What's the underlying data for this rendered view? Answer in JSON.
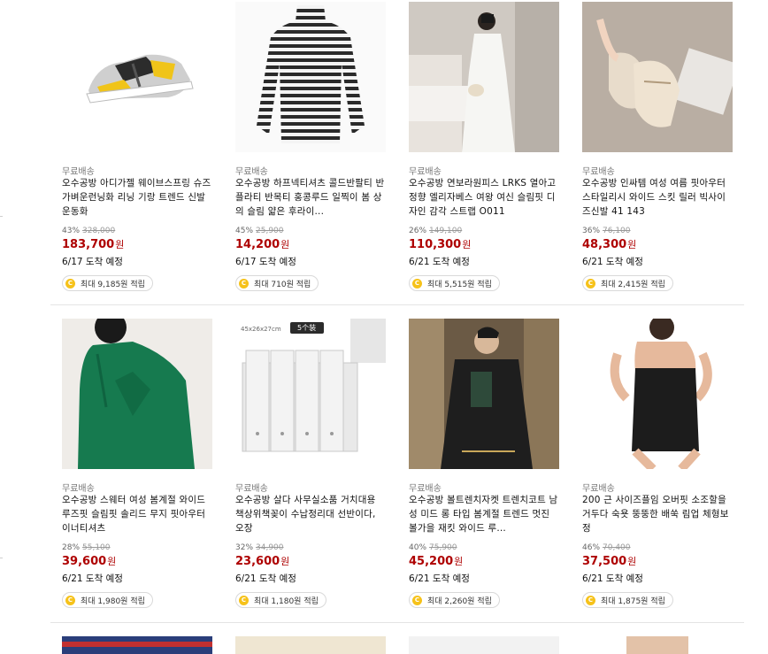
{
  "products": [
    {
      "shipping": "무료배송",
      "title": "오수공방 아디가젤 웨이브스프링 슈즈 가벼운런닝화 리닝 기랑 트렌드 신발 운동화",
      "discount": "43%",
      "original_price": "328,000",
      "price": "183,700",
      "won": "원",
      "arrival": "6/17 도착 예정",
      "points": "최대 9,185원 적립",
      "image": "sneaker"
    },
    {
      "shipping": "무료배송",
      "title": "오수공방 하프넥티셔츠 콜드반팔티 반플라티 반목티 홍콩루드 일찍이 봄 상의 슬림 얇은 후라이...",
      "discount": "45%",
      "original_price": "25,900",
      "price": "14,200",
      "won": "원",
      "arrival": "6/17 도착 예정",
      "points": "최대 710원 적립",
      "image": "striped-turtleneck"
    },
    {
      "shipping": "무료배송",
      "title": "오수공방 연보라원피스 LRKS 열아고 정향 엘리자베스 여왕 여신 슬림핏 디자인 감각 스트랩 O011",
      "discount": "26%",
      "original_price": "149,100",
      "price": "110,300",
      "won": "원",
      "arrival": "6/21 도착 예정",
      "points": "최대 5,515원 적립",
      "image": "white-dress"
    },
    {
      "shipping": "무료배송",
      "title": "오수공방 인싸템 여성 여름 핏아우터 스타일리시 와이드 스킷 릴러 빅사이즈신발 41 143",
      "discount": "36%",
      "original_price": "76,100",
      "price": "48,300",
      "won": "원",
      "arrival": "6/21 도착 예정",
      "points": "최대 2,415원 적립",
      "image": "tweed-loafers"
    },
    {
      "shipping": "무료배송",
      "title": "오수공방 스웨터 여성 봄계절 와이드 루즈핏 슬림핏 솔리드 무지 핏아우터 이너티셔츠",
      "discount": "28%",
      "original_price": "55,100",
      "price": "39,600",
      "won": "원",
      "arrival": "6/21 도착 예정",
      "points": "최대 1,980원 적립",
      "image": "green-sweater"
    },
    {
      "shipping": "무료배송",
      "title": "오수공방 살다 사무실소품 거치대용 책상위책꽂이 수납정리대 선반이다, 오장",
      "discount": "32%",
      "original_price": "34,900",
      "price": "23,600",
      "won": "원",
      "arrival": "6/21 도착 예정",
      "points": "최대 1,180원 적립",
      "image": "file-organizer",
      "image_dim": "45x26x27cm",
      "image_badge": "5个装"
    },
    {
      "shipping": "무료배송",
      "title": "오수공방 볼트렌치자켓 트렌치코트 남성 미드 롱 타입 봄계절 트렌드 멋진 볼가을 재킷 와이드 루...",
      "discount": "40%",
      "original_price": "75,900",
      "price": "45,200",
      "won": "원",
      "arrival": "6/21 도착 예정",
      "points": "최대 2,260원 적립",
      "image": "black-jacket"
    },
    {
      "shipping": "무료배송",
      "title": "200 근 사이즈플임 오버핏 소조할을 거두다 숙욧 뚱뚱한 배쑥 림업 체형보정",
      "discount": "46%",
      "original_price": "70,400",
      "price": "37,500",
      "won": "원",
      "arrival": "6/21 도착 예정",
      "points": "최대 1,875원 적립",
      "image": "shapewear"
    }
  ],
  "icons": {
    "coin": "coin-icon"
  },
  "colors": {
    "price": "#ae0000",
    "coin": "#f6c21a"
  }
}
